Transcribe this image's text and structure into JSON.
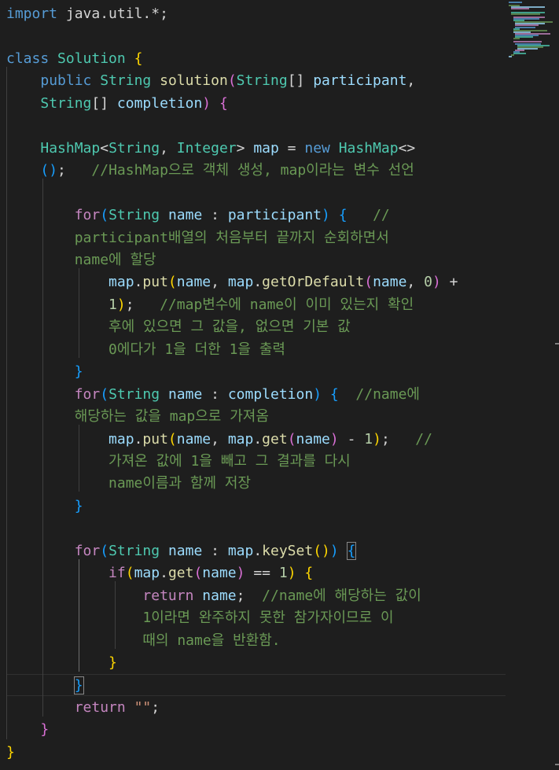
{
  "editor": {
    "language": "java",
    "colors": {
      "background": "#1e1e1e",
      "keyword": "#569cd6",
      "control": "#c586c0",
      "type": "#4ec9b0",
      "function": "#dcdcaa",
      "variable": "#9cdcfe",
      "number": "#b5cea8",
      "comment": "#6a9955",
      "string": "#ce9178"
    },
    "lines": [
      [
        [
          "k",
          "import"
        ],
        [
          "p",
          " java.util.*;"
        ]
      ],
      [],
      [
        [
          "k",
          "class"
        ],
        [
          "p",
          " "
        ],
        [
          "t",
          "Solution"
        ],
        [
          "p",
          " "
        ],
        [
          "gold",
          "{"
        ]
      ],
      [
        [
          "p",
          "    "
        ],
        [
          "k",
          "public"
        ],
        [
          "p",
          " "
        ],
        [
          "t",
          "String"
        ],
        [
          "p",
          " "
        ],
        [
          "f",
          "solution"
        ],
        [
          "ppl",
          "("
        ],
        [
          "t",
          "String"
        ],
        [
          "p",
          "[] "
        ],
        [
          "v",
          "participant"
        ],
        [
          "p",
          ","
        ]
      ],
      [
        [
          "p",
          "    "
        ],
        [
          "t",
          "String"
        ],
        [
          "p",
          "[] "
        ],
        [
          "v",
          "completion"
        ],
        [
          "ppl",
          ")"
        ],
        [
          "p",
          " "
        ],
        [
          "ppl",
          "{"
        ]
      ],
      [],
      [
        [
          "p",
          "    "
        ],
        [
          "t",
          "HashMap"
        ],
        [
          "p",
          "<"
        ],
        [
          "t",
          "String"
        ],
        [
          "p",
          ", "
        ],
        [
          "t",
          "Integer"
        ],
        [
          "p",
          "> "
        ],
        [
          "v",
          "map"
        ],
        [
          "p",
          " = "
        ],
        [
          "k",
          "new"
        ],
        [
          "p",
          " "
        ],
        [
          "t",
          "HashMap"
        ],
        [
          "p",
          "<>"
        ]
      ],
      [
        [
          "p",
          "    "
        ],
        [
          "blu",
          "()"
        ],
        [
          "p",
          ";   "
        ],
        [
          "c",
          "//HashMap으로 객체 생성, map이라는 변수 선언"
        ]
      ],
      [],
      [
        [
          "p",
          "        "
        ],
        [
          "ctl",
          "for"
        ],
        [
          "blu",
          "("
        ],
        [
          "t",
          "String"
        ],
        [
          "p",
          " "
        ],
        [
          "v",
          "name"
        ],
        [
          "p",
          " : "
        ],
        [
          "v",
          "participant"
        ],
        [
          "blu",
          ")"
        ],
        [
          "p",
          " "
        ],
        [
          "blu",
          "{"
        ],
        [
          "p",
          "   "
        ],
        [
          "c",
          "//"
        ]
      ],
      [
        [
          "p",
          "        "
        ],
        [
          "c",
          "participant배열의 처음부터 끝까지 순회하면서"
        ]
      ],
      [
        [
          "p",
          "        "
        ],
        [
          "c",
          "name에 할당"
        ]
      ],
      [
        [
          "p",
          "            "
        ],
        [
          "v",
          "map"
        ],
        [
          "p",
          "."
        ],
        [
          "f",
          "put"
        ],
        [
          "gold",
          "("
        ],
        [
          "v",
          "name"
        ],
        [
          "p",
          ", "
        ],
        [
          "v",
          "map"
        ],
        [
          "p",
          "."
        ],
        [
          "f",
          "getOrDefault"
        ],
        [
          "ppl",
          "("
        ],
        [
          "v",
          "name"
        ],
        [
          "p",
          ", "
        ],
        [
          "n",
          "0"
        ],
        [
          "ppl",
          ")"
        ],
        [
          "p",
          " +"
        ]
      ],
      [
        [
          "p",
          "            "
        ],
        [
          "n",
          "1"
        ],
        [
          "gold",
          ")"
        ],
        [
          "p",
          ";   "
        ],
        [
          "c",
          "//map변수에 name이 이미 있는지 확인"
        ]
      ],
      [
        [
          "p",
          "            "
        ],
        [
          "c",
          "후에 있으면 그 값을, 없으면 기본 값"
        ]
      ],
      [
        [
          "p",
          "            "
        ],
        [
          "c",
          "0에다가 1을 더한 1을 출력"
        ]
      ],
      [
        [
          "p",
          "        "
        ],
        [
          "blu",
          "}"
        ]
      ],
      [
        [
          "p",
          "        "
        ],
        [
          "ctl",
          "for"
        ],
        [
          "blu",
          "("
        ],
        [
          "t",
          "String"
        ],
        [
          "p",
          " "
        ],
        [
          "v",
          "name"
        ],
        [
          "p",
          " : "
        ],
        [
          "v",
          "completion"
        ],
        [
          "blu",
          ")"
        ],
        [
          "p",
          " "
        ],
        [
          "blu",
          "{"
        ],
        [
          "p",
          "  "
        ],
        [
          "c",
          "//name에"
        ]
      ],
      [
        [
          "p",
          "        "
        ],
        [
          "c",
          "해당하는 값을 map으로 가져옴"
        ]
      ],
      [
        [
          "p",
          "            "
        ],
        [
          "v",
          "map"
        ],
        [
          "p",
          "."
        ],
        [
          "f",
          "put"
        ],
        [
          "gold",
          "("
        ],
        [
          "v",
          "name"
        ],
        [
          "p",
          ", "
        ],
        [
          "v",
          "map"
        ],
        [
          "p",
          "."
        ],
        [
          "f",
          "get"
        ],
        [
          "ppl",
          "("
        ],
        [
          "v",
          "name"
        ],
        [
          "ppl",
          ")"
        ],
        [
          "p",
          " - "
        ],
        [
          "n",
          "1"
        ],
        [
          "gold",
          ")"
        ],
        [
          "p",
          ";   "
        ],
        [
          "c",
          "//"
        ]
      ],
      [
        [
          "p",
          "            "
        ],
        [
          "c",
          "가져온 값에 1을 빼고 그 결과를 다시"
        ]
      ],
      [
        [
          "p",
          "            "
        ],
        [
          "c",
          "name이름과 함께 저장"
        ]
      ],
      [
        [
          "p",
          "        "
        ],
        [
          "blu",
          "}"
        ]
      ],
      [],
      [
        [
          "p",
          "        "
        ],
        [
          "ctl",
          "for"
        ],
        [
          "blu",
          "("
        ],
        [
          "t",
          "String"
        ],
        [
          "p",
          " "
        ],
        [
          "v",
          "name"
        ],
        [
          "p",
          " : "
        ],
        [
          "v",
          "map"
        ],
        [
          "p",
          "."
        ],
        [
          "f",
          "keySet"
        ],
        [
          "gold",
          "()"
        ],
        [
          "blu",
          ")"
        ],
        [
          "p",
          " "
        ],
        [
          "bm",
          "{"
        ]
      ],
      [
        [
          "p",
          "            "
        ],
        [
          "ctl",
          "if"
        ],
        [
          "gold",
          "("
        ],
        [
          "v",
          "map"
        ],
        [
          "p",
          "."
        ],
        [
          "f",
          "get"
        ],
        [
          "ppl",
          "("
        ],
        [
          "v",
          "name"
        ],
        [
          "ppl",
          ")"
        ],
        [
          "p",
          " == "
        ],
        [
          "n",
          "1"
        ],
        [
          "gold",
          ")"
        ],
        [
          "p",
          " "
        ],
        [
          "gold",
          "{"
        ]
      ],
      [
        [
          "p",
          "                "
        ],
        [
          "ctl",
          "return"
        ],
        [
          "p",
          " "
        ],
        [
          "v",
          "name"
        ],
        [
          "p",
          ";  "
        ],
        [
          "c",
          "//name에 해당하는 값이"
        ]
      ],
      [
        [
          "p",
          "                "
        ],
        [
          "c",
          "1이라면 완주하지 못한 참가자이므로 이"
        ]
      ],
      [
        [
          "p",
          "                "
        ],
        [
          "c",
          "때의 name을 반환함."
        ]
      ],
      [
        [
          "p",
          "            "
        ],
        [
          "gold",
          "}"
        ]
      ],
      [
        [
          "p",
          "        "
        ],
        [
          "bm",
          "}"
        ]
      ],
      [
        [
          "p",
          "        "
        ],
        [
          "ctl",
          "return"
        ],
        [
          "p",
          " "
        ],
        [
          "s",
          "\"\""
        ],
        [
          "p",
          ";"
        ]
      ],
      [
        [
          "p",
          "    "
        ],
        [
          "ppl",
          "}"
        ]
      ],
      [
        [
          "gold",
          "}"
        ]
      ]
    ]
  },
  "minimap": {
    "colors": [
      "#569cd6",
      "#4ec9b0",
      "#6a9955",
      "#9cdcfe",
      "#c586c0"
    ]
  }
}
